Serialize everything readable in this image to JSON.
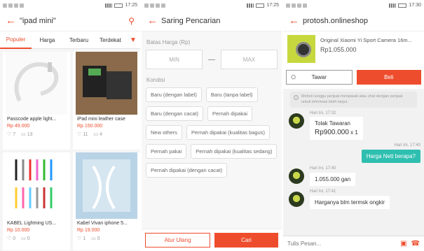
{
  "status_bars": [
    {
      "time": "17:25"
    },
    {
      "time": "17:25"
    },
    {
      "time": "17:30"
    }
  ],
  "panel1": {
    "title": "\"ipad mini\"",
    "tabs": [
      "Populer",
      "Harga",
      "Terbaru",
      "Terdekat"
    ],
    "products": [
      {
        "name": "Passcode apple light...",
        "price": "Rp 49.000",
        "likes": "7",
        "comments": "13"
      },
      {
        "name": "iPad mini leather case",
        "price": "Rp 150.000",
        "likes": "11",
        "comments": "4"
      },
      {
        "name": "KABEL Lightning US...",
        "price": "Rp 10.000",
        "likes": "0",
        "comments": "0"
      },
      {
        "name": "Kabel Vivan iphone 5...",
        "price": "Rp 19.000",
        "likes": "1",
        "comments": "0"
      }
    ]
  },
  "panel2": {
    "title": "Saring Pencarian",
    "price_section": "Batas Harga (Rp)",
    "min_placeholder": "MIN",
    "max_placeholder": "MAX",
    "condition_section": "Kondisi",
    "chips": [
      "Baru (dengan label)",
      "Baru (tanpa label)",
      "Baru (dengan cacat)",
      "Pernah dipakai",
      "New others",
      "Pernah dipakai (kualitas bagus)",
      "Pernah pakai",
      "Pernah dipakai (kualitas sedang)",
      "Pernah dipakai (dengan cacat)"
    ],
    "reset_label": "Atur Ulang",
    "search_label": "Cari"
  },
  "panel3": {
    "title": "protosh.onlineshop",
    "product_name": "Original Xiaomi Yi Sport Camera 16m...",
    "product_price": "Rp1.055.000",
    "tawar_label": "Tawar",
    "beli_label": "Beli",
    "notice": "Mohon tunggu penjual menjawab atau chat dengan penjual untuk informasi lebih lanjut.",
    "messages": [
      {
        "time": "Hari Ini, 17:32",
        "line1": "Tolak Tawaran",
        "line2": "Rp900.000",
        "qty": "x 1"
      },
      {
        "time": "Hari Ini, 17:40",
        "text": "Harga Nett berapa?"
      },
      {
        "time": "Hari Ini, 17:40",
        "text": "1.055.000 gan"
      },
      {
        "time": "Hari Ini, 17:41",
        "text": "Harganya blm termsk ongkir"
      }
    ],
    "input_placeholder": "Tulis Pesan..."
  }
}
